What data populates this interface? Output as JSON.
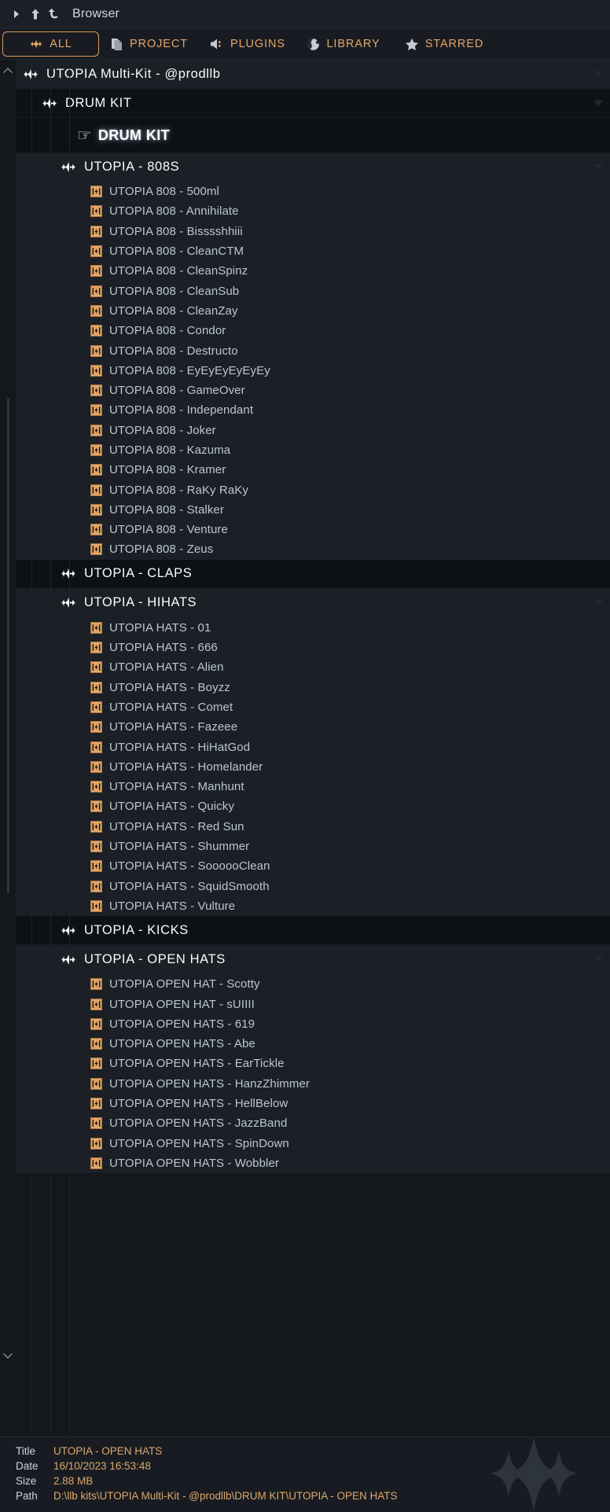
{
  "titlebar": {
    "label": "Browser",
    "icons": [
      "chevron-right-icon",
      "arrow-up-icon",
      "undo-icon"
    ]
  },
  "tabs": [
    {
      "label": "ALL",
      "icon": "waveform-icon",
      "selected": true
    },
    {
      "label": "PROJECT",
      "icon": "documents-icon",
      "selected": false
    },
    {
      "label": "PLUGINS",
      "icon": "speaker-icon",
      "selected": false
    },
    {
      "label": "LIBRARY",
      "icon": "globe-icon",
      "selected": false
    },
    {
      "label": "STARRED",
      "icon": "star-icon",
      "selected": false
    }
  ],
  "colors": {
    "accent": "#e5a668",
    "accent_border": "#d99a5b",
    "file_icon_bg": "#e2a76a",
    "file_text": "#b9c6d6",
    "group_text": "#fbfcfd",
    "background": "#14171c",
    "row_background": "#1c2026",
    "group_background": "#0d1014"
  },
  "tree": [
    {
      "type": "group",
      "indent": 0,
      "icon": "waveform-icon",
      "label": "UTOPIA Multi-Kit - @prodllb",
      "expanded": true,
      "chevron": true
    },
    {
      "type": "group",
      "indent": 1,
      "icon": "waveform-icon",
      "label": "DRUM KIT",
      "expanded": true,
      "chevron": true
    },
    {
      "type": "banner",
      "indent": 2,
      "icon": "pointing-hand-icon",
      "label": "DRUM KIT"
    },
    {
      "type": "group",
      "indent": 2,
      "icon": "waveform-icon",
      "label": "UTOPIA - 808S",
      "expanded": true,
      "chevron": true
    },
    {
      "type": "file",
      "indent": 3,
      "icon": "audio-file-icon",
      "label": "UTOPIA 808 - 500ml"
    },
    {
      "type": "file",
      "indent": 3,
      "icon": "audio-file-icon",
      "label": "UTOPIA 808 - Annihilate"
    },
    {
      "type": "file",
      "indent": 3,
      "icon": "audio-file-icon",
      "label": "UTOPIA 808 - Bisssshhiii"
    },
    {
      "type": "file",
      "indent": 3,
      "icon": "audio-file-icon",
      "label": "UTOPIA 808 - CleanCTM"
    },
    {
      "type": "file",
      "indent": 3,
      "icon": "audio-file-icon",
      "label": "UTOPIA 808 - CleanSpinz"
    },
    {
      "type": "file",
      "indent": 3,
      "icon": "audio-file-icon",
      "label": "UTOPIA 808 - CleanSub"
    },
    {
      "type": "file",
      "indent": 3,
      "icon": "audio-file-icon",
      "label": "UTOPIA 808 - CleanZay"
    },
    {
      "type": "file",
      "indent": 3,
      "icon": "audio-file-icon",
      "label": "UTOPIA 808 - Condor"
    },
    {
      "type": "file",
      "indent": 3,
      "icon": "audio-file-icon",
      "label": "UTOPIA 808 - Destructo"
    },
    {
      "type": "file",
      "indent": 3,
      "icon": "audio-file-icon",
      "label": "UTOPIA 808 - EyEyEyEyEyEy"
    },
    {
      "type": "file",
      "indent": 3,
      "icon": "audio-file-icon",
      "label": "UTOPIA 808 - GameOver"
    },
    {
      "type": "file",
      "indent": 3,
      "icon": "audio-file-icon",
      "label": "UTOPIA 808 - Independant"
    },
    {
      "type": "file",
      "indent": 3,
      "icon": "audio-file-icon",
      "label": "UTOPIA 808 - Joker"
    },
    {
      "type": "file",
      "indent": 3,
      "icon": "audio-file-icon",
      "label": "UTOPIA 808 - Kazuma"
    },
    {
      "type": "file",
      "indent": 3,
      "icon": "audio-file-icon",
      "label": "UTOPIA 808 - Kramer"
    },
    {
      "type": "file",
      "indent": 3,
      "icon": "audio-file-icon",
      "label": "UTOPIA 808 - RaKy RaKy"
    },
    {
      "type": "file",
      "indent": 3,
      "icon": "audio-file-icon",
      "label": "UTOPIA 808 - Stalker"
    },
    {
      "type": "file",
      "indent": 3,
      "icon": "audio-file-icon",
      "label": "UTOPIA 808 - Venture"
    },
    {
      "type": "file",
      "indent": 3,
      "icon": "audio-file-icon",
      "label": "UTOPIA 808 - Zeus"
    },
    {
      "type": "group",
      "indent": 2,
      "icon": "waveform-icon",
      "label": "UTOPIA - CLAPS",
      "expanded": false,
      "chevron": false
    },
    {
      "type": "group",
      "indent": 2,
      "icon": "waveform-icon",
      "label": "UTOPIA - HIHATS",
      "expanded": true,
      "chevron": true
    },
    {
      "type": "file",
      "indent": 3,
      "icon": "audio-file-icon",
      "label": "UTOPIA HATS - 01"
    },
    {
      "type": "file",
      "indent": 3,
      "icon": "audio-file-icon",
      "label": "UTOPIA HATS - 666"
    },
    {
      "type": "file",
      "indent": 3,
      "icon": "audio-file-icon",
      "label": "UTOPIA HATS - Alien"
    },
    {
      "type": "file",
      "indent": 3,
      "icon": "audio-file-icon",
      "label": "UTOPIA HATS - Boyzz"
    },
    {
      "type": "file",
      "indent": 3,
      "icon": "audio-file-icon",
      "label": "UTOPIA HATS - Comet"
    },
    {
      "type": "file",
      "indent": 3,
      "icon": "audio-file-icon",
      "label": "UTOPIA HATS - Fazeee"
    },
    {
      "type": "file",
      "indent": 3,
      "icon": "audio-file-icon",
      "label": "UTOPIA HATS - HiHatGod"
    },
    {
      "type": "file",
      "indent": 3,
      "icon": "audio-file-icon",
      "label": "UTOPIA HATS - Homelander"
    },
    {
      "type": "file",
      "indent": 3,
      "icon": "audio-file-icon",
      "label": "UTOPIA HATS - Manhunt"
    },
    {
      "type": "file",
      "indent": 3,
      "icon": "audio-file-icon",
      "label": "UTOPIA HATS - Quicky"
    },
    {
      "type": "file",
      "indent": 3,
      "icon": "audio-file-icon",
      "label": "UTOPIA HATS - Red Sun"
    },
    {
      "type": "file",
      "indent": 3,
      "icon": "audio-file-icon",
      "label": "UTOPIA HATS - Shummer"
    },
    {
      "type": "file",
      "indent": 3,
      "icon": "audio-file-icon",
      "label": "UTOPIA HATS - SoooooClean"
    },
    {
      "type": "file",
      "indent": 3,
      "icon": "audio-file-icon",
      "label": "UTOPIA HATS - SquidSmooth"
    },
    {
      "type": "file",
      "indent": 3,
      "icon": "audio-file-icon",
      "label": "UTOPIA HATS - Vulture"
    },
    {
      "type": "group",
      "indent": 2,
      "icon": "waveform-icon",
      "label": "UTOPIA - KICKS",
      "expanded": false,
      "chevron": false
    },
    {
      "type": "group",
      "indent": 2,
      "icon": "waveform-icon",
      "label": "UTOPIA - OPEN HATS",
      "expanded": true,
      "chevron": true
    },
    {
      "type": "file",
      "indent": 3,
      "icon": "audio-file-icon",
      "label": "UTOPIA OPEN HAT - Scotty"
    },
    {
      "type": "file",
      "indent": 3,
      "icon": "audio-file-icon",
      "label": "UTOPIA OPEN HAT - sUIIII"
    },
    {
      "type": "file",
      "indent": 3,
      "icon": "audio-file-icon",
      "label": "UTOPIA OPEN HATS - 619"
    },
    {
      "type": "file",
      "indent": 3,
      "icon": "audio-file-icon",
      "label": "UTOPIA OPEN HATS - Abe"
    },
    {
      "type": "file",
      "indent": 3,
      "icon": "audio-file-icon",
      "label": "UTOPIA OPEN HATS - EarTickle"
    },
    {
      "type": "file",
      "indent": 3,
      "icon": "audio-file-icon",
      "label": "UTOPIA OPEN HATS - HanzZhimmer"
    },
    {
      "type": "file",
      "indent": 3,
      "icon": "audio-file-icon",
      "label": "UTOPIA OPEN HATS - HellBelow"
    },
    {
      "type": "file",
      "indent": 3,
      "icon": "audio-file-icon",
      "label": "UTOPIA OPEN HATS - JazzBand"
    },
    {
      "type": "file",
      "indent": 3,
      "icon": "audio-file-icon",
      "label": "UTOPIA OPEN HATS - SpinDown"
    },
    {
      "type": "file",
      "indent": 3,
      "icon": "audio-file-icon",
      "label": "UTOPIA OPEN HATS - Wobbler"
    }
  ],
  "info": {
    "rows": [
      {
        "key": "Title",
        "value": "UTOPIA - OPEN HATS"
      },
      {
        "key": "Date",
        "value": "16/10/2023 16:53:48"
      },
      {
        "key": "Size",
        "value": "2.88 MB"
      },
      {
        "key": "Path",
        "value": "D:\\llb kits\\UTOPIA Multi-Kit - @prodllb\\DRUM KIT\\UTOPIA - OPEN HATS"
      }
    ],
    "logo": "waveform-logo-icon"
  }
}
